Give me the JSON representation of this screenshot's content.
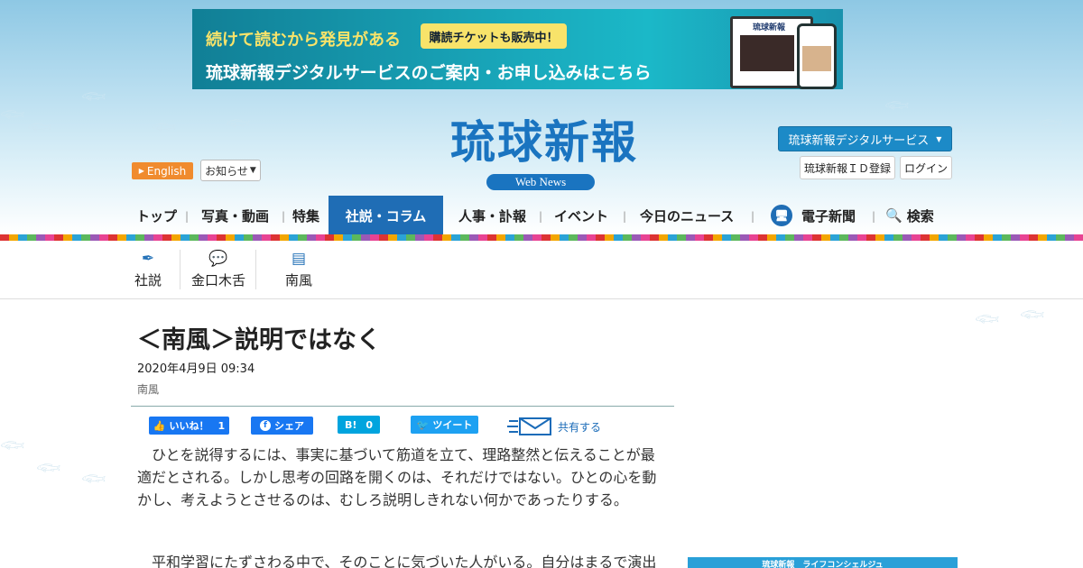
{
  "banner": {
    "tagline": "続けて読むから発見がある",
    "ticket": "購読チケットも販売中！",
    "service": "琉球新報デジタルサービスのご案内・お申し込みはこちら",
    "device_masthead": "琉球新報"
  },
  "header": {
    "logo": "琉球新報",
    "subtitle": "Web News",
    "english_label": "English",
    "notice_label": "お知らせ",
    "digital_service_label": "琉球新報デジタルサービス",
    "id_register_label": "琉球新報ＩＤ登録",
    "login_label": "ログイン"
  },
  "nav": {
    "items": [
      "トップ",
      "写真・動画",
      "特集",
      "社説・コラム",
      "人事・訃報",
      "イベント",
      "今日のニュース",
      "電子新聞",
      "検索"
    ]
  },
  "subnav": {
    "items": [
      {
        "label": "社説",
        "icon": "pen-icon"
      },
      {
        "label": "金口木舌",
        "icon": "speech-bubble-icon"
      },
      {
        "label": "南風",
        "icon": "comment-icon"
      }
    ]
  },
  "article": {
    "title": "＜南風＞説明ではなく",
    "date": "2020年4月9日 09:34",
    "category": "南風",
    "paragraphs": [
      "ひとを説得するには、事実に基づいて筋道を立て、理路整然と伝えることが最適だとされる。しかし思考の回路を開くのは、それだけではない。ひとの心を動かし、考えようとさせるのは、むしろ説明しきれない何かであったりする。",
      "平和学習にたずさわる中で、そのことに気づいた人がいる。自分はまるで演出"
    ]
  },
  "share": {
    "like_label": "いいね！",
    "like_count": "1",
    "fb_share_label": "シェア",
    "hatena_label": "B!",
    "hatena_count": "0",
    "tweet_label": "ツイート",
    "share_label": "共有する"
  },
  "sidebar": {
    "concierge_label": "琉球新報　ライフコンシェルジュ"
  },
  "colors": {
    "brand_blue": "#1a74c0",
    "nav_active": "#1f6db5",
    "english_orange": "#f08b2e",
    "facebook": "#1877f2",
    "twitter": "#1da1f2",
    "hatena": "#00a4de"
  }
}
